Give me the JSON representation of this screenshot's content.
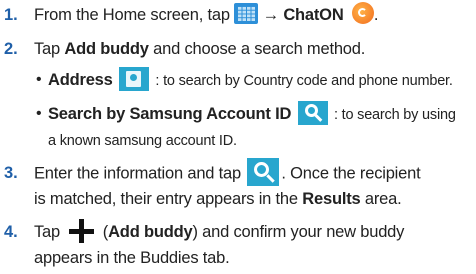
{
  "steps": [
    {
      "number": "1.",
      "parts": [
        "From the Home screen, tap",
        "→",
        "ChatON",
        "."
      ]
    },
    {
      "number": "2.",
      "parts": [
        "Tap",
        "Add buddy",
        "and choose a search method."
      ],
      "bullets": [
        {
          "bold": "Address",
          "text": ": to search by Country code and phone number."
        },
        {
          "bold": "Search by Samsung Account ID",
          "text": ": to search by using",
          "text2": "a known samsung account ID."
        }
      ]
    },
    {
      "number": "3.",
      "line1": [
        "Enter the information and tap",
        ". Once the recipient"
      ],
      "line2": [
        "is matched, their entry appears in the",
        "Results",
        "area."
      ]
    },
    {
      "number": "4.",
      "line1": [
        "Tap",
        "(",
        "Add buddy",
        ") and confirm your new buddy"
      ],
      "line2": "appears in the Buddies tab."
    }
  ],
  "icons": {
    "apps": "apps-grid-icon",
    "chaton": "chaton-app-icon",
    "address": "address-book-icon",
    "search": "search-icon",
    "add": "plus-icon"
  },
  "colors": {
    "step_number": "#1f5fa8",
    "icon_blue": "#28a6ce",
    "chaton_orange": "#f26b1d"
  }
}
